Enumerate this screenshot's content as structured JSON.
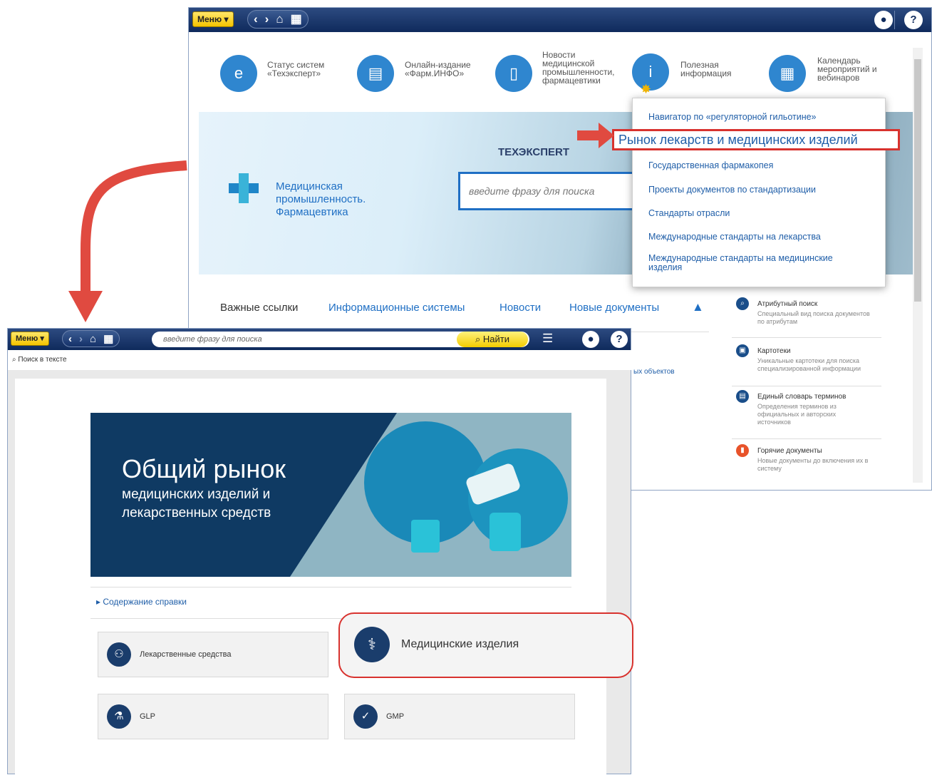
{
  "top_window": {
    "menu_label": "Меню",
    "quick_links": [
      {
        "label": "Статус систем «Техэксперт»",
        "icon": "status-icon"
      },
      {
        "label": "Онлайн-издание «Фарм.ИНФО»",
        "icon": "screen-icon"
      },
      {
        "label": "Новости медицинской промышленности, фармацевтики",
        "icon": "document-icon"
      },
      {
        "label": "Полезная информация",
        "icon": "info-icon"
      },
      {
        "label": "Календарь мероприятий и вебинаров",
        "icon": "calendar-icon"
      }
    ],
    "brand": {
      "name": "Медицинская промышленность. Фармацевтика",
      "logo_text": "ТЕХЭКСПЕRТ"
    },
    "search_placeholder": "введите фразу для поиска",
    "dropdown": [
      "Навигатор по «регуляторной гильотине»",
      "Рынок лекарств и медицинских изделий",
      "Государственная фармакопея",
      "Проекты документов по стандартизации",
      "Стандарты отрасли",
      "Международные стандарты на лекарства",
      "Международные стандарты на медицинские изделия"
    ],
    "tabs": [
      "Важные ссылки",
      "Информационные системы",
      "Новости",
      "Новые документы"
    ],
    "right_panel": [
      {
        "title": "Атрибутный поиск",
        "desc": "Специальный вид поиска документов по атрибутам"
      },
      {
        "title": "Картотеки",
        "desc": "Уникальные картотеки для поиска специализированной информации"
      },
      {
        "title": "Единый словарь терминов",
        "desc": "Определения терминов из официальных и авторских источников"
      },
      {
        "title": "Горячие документы",
        "desc": "Новые документы до включения их в систему"
      }
    ],
    "fragment_text": "ых объектов"
  },
  "bottom_window": {
    "menu_label": "Меню",
    "search_placeholder": "введите фразу для поиска",
    "find_label": "Найти",
    "subbar_label": "Поиск в тексте",
    "hero": {
      "title": "Общий рынок",
      "subtitle": "медицинских изделий и лекарственных средств"
    },
    "contents_link": "Содержание справки",
    "cards": [
      {
        "label": "Лекарственные средства",
        "icon": "pills-icon"
      },
      {
        "label": "Медицинские изделия",
        "icon": "stethoscope-icon"
      },
      {
        "label": "GLP",
        "icon": "lab-icon"
      },
      {
        "label": "GMP",
        "icon": "badge-icon"
      }
    ]
  },
  "colors": {
    "accent": "#1f6fc4",
    "highlight": "#d8322e",
    "toolbar": "#0f2a5c",
    "menu": "#f5c400"
  }
}
